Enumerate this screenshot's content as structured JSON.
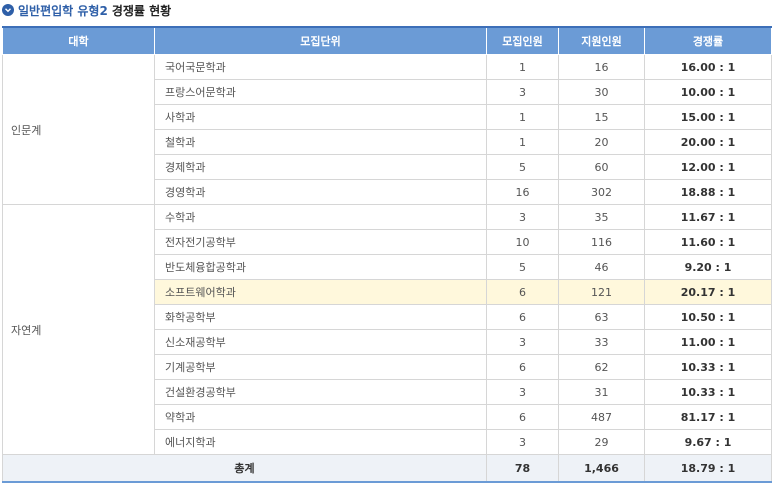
{
  "title": {
    "blue_part": "일반편입학 유형2",
    "dark_part": "경쟁률 현황",
    "icon": "chevron-down-circle-icon"
  },
  "table": {
    "headers": [
      "대학",
      "모집단위",
      "모집인원",
      "지원인원",
      "경쟁률"
    ],
    "groups": [
      {
        "college": "인문계",
        "rows": [
          {
            "unit": "국어국문학과",
            "quota": "1",
            "applicants": "16",
            "ratio": "16.00 : 1"
          },
          {
            "unit": "프랑스어문학과",
            "quota": "3",
            "applicants": "30",
            "ratio": "10.00 : 1"
          },
          {
            "unit": "사학과",
            "quota": "1",
            "applicants": "15",
            "ratio": "15.00 : 1"
          },
          {
            "unit": "철학과",
            "quota": "1",
            "applicants": "20",
            "ratio": "20.00 : 1"
          },
          {
            "unit": "경제학과",
            "quota": "5",
            "applicants": "60",
            "ratio": "12.00 : 1"
          },
          {
            "unit": "경영학과",
            "quota": "16",
            "applicants": "302",
            "ratio": "18.88 : 1"
          }
        ]
      },
      {
        "college": "자연계",
        "rows": [
          {
            "unit": "수학과",
            "quota": "3",
            "applicants": "35",
            "ratio": "11.67 : 1"
          },
          {
            "unit": "전자전기공학부",
            "quota": "10",
            "applicants": "116",
            "ratio": "11.60 : 1"
          },
          {
            "unit": "반도체융합공학과",
            "quota": "5",
            "applicants": "46",
            "ratio": "9.20 : 1"
          },
          {
            "unit": "소프트웨어학과",
            "quota": "6",
            "applicants": "121",
            "ratio": "20.17 : 1",
            "highlight": true
          },
          {
            "unit": "화학공학부",
            "quota": "6",
            "applicants": "63",
            "ratio": "10.50 : 1"
          },
          {
            "unit": "신소재공학부",
            "quota": "3",
            "applicants": "33",
            "ratio": "11.00 : 1"
          },
          {
            "unit": "기계공학부",
            "quota": "6",
            "applicants": "62",
            "ratio": "10.33 : 1"
          },
          {
            "unit": "건설환경공학부",
            "quota": "3",
            "applicants": "31",
            "ratio": "10.33 : 1"
          },
          {
            "unit": "약학과",
            "quota": "6",
            "applicants": "487",
            "ratio": "81.17 : 1"
          },
          {
            "unit": "에너지학과",
            "quota": "3",
            "applicants": "29",
            "ratio": "9.67 : 1"
          }
        ]
      }
    ],
    "total": {
      "label": "총계",
      "quota": "78",
      "applicants": "1,466",
      "ratio": "18.79 : 1"
    }
  },
  "colors": {
    "header_bg": "#6b9bd6",
    "title_blue": "#2e5fa8",
    "highlight_bg": "#fff8dc",
    "total_bg": "#eef2f7"
  }
}
